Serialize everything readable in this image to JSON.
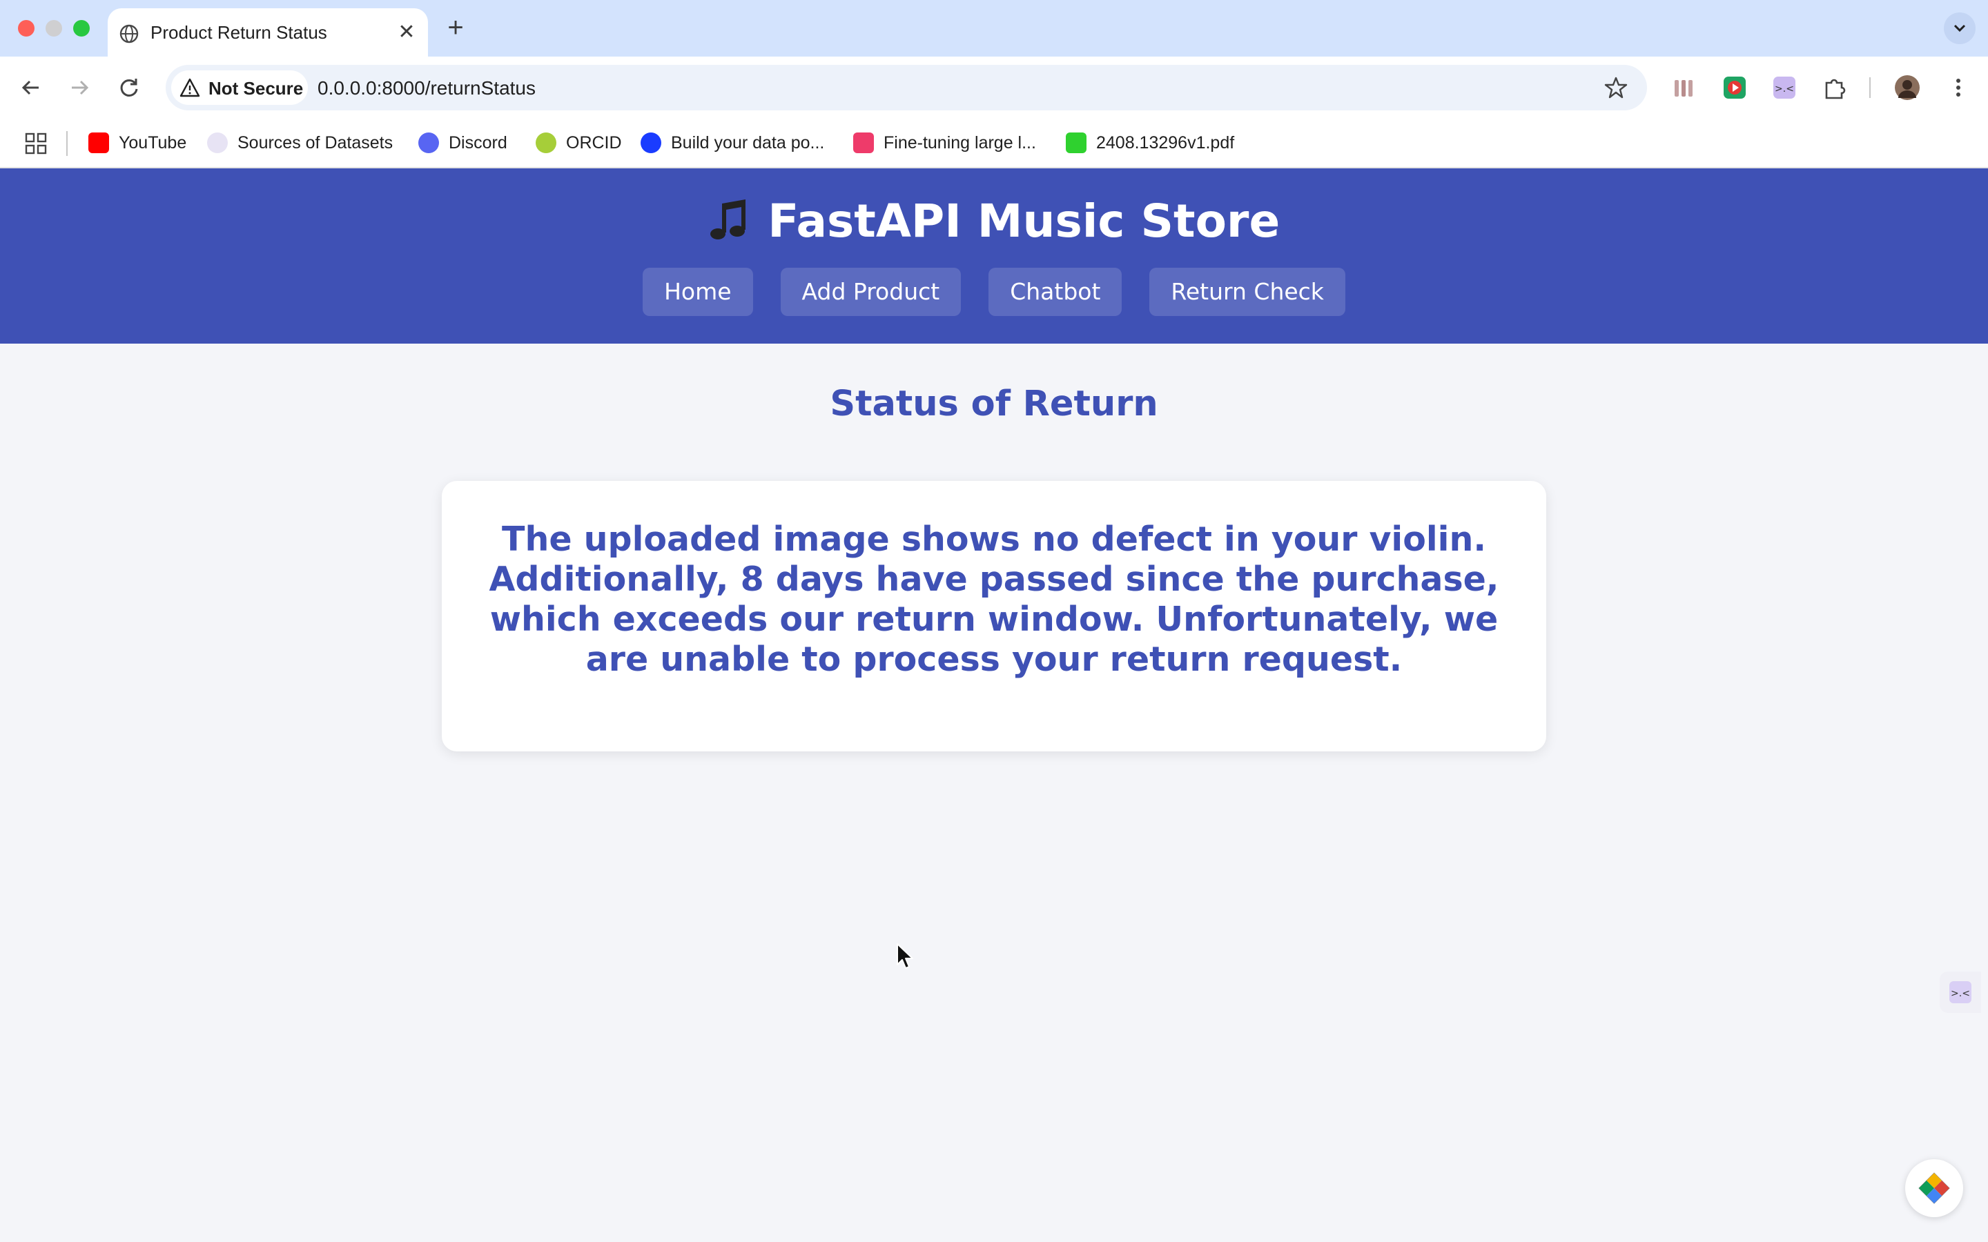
{
  "browser": {
    "tab": {
      "title": "Product Return Status",
      "close_glyph": "✕",
      "new_tab_glyph": "+"
    },
    "address_bar": {
      "security_label": "Not Secure",
      "url": "0.0.0.0:8000/returnStatus"
    },
    "bookmarks": [
      {
        "label": "YouTube",
        "icon": "youtube-icon"
      },
      {
        "label": "Sources of Datasets",
        "icon": "datasets-icon"
      },
      {
        "label": "Discord",
        "icon": "discord-icon"
      },
      {
        "label": "ORCID",
        "icon": "orcid-icon"
      },
      {
        "label": "Build your data po...",
        "icon": "d-icon"
      },
      {
        "label": "Fine-tuning large l...",
        "icon": "finetune-icon"
      },
      {
        "label": "2408.13296v1.pdf",
        "icon": "pdf-icon"
      }
    ]
  },
  "site": {
    "title": "FastAPI Music Store",
    "title_icon": "musical-note-icon",
    "nav": [
      {
        "label": "Home"
      },
      {
        "label": "Add Product"
      },
      {
        "label": "Chatbot"
      },
      {
        "label": "Return Check"
      }
    ]
  },
  "page": {
    "heading": "Status of Return",
    "message": "The uploaded image shows no defect in your violin. Additionally, 8 days have passed since the purchase, which exceeds our return window. Unfortunately, we are unable to process your return request."
  },
  "colors": {
    "header_bg": "#3f51b5",
    "nav_button_bg": "#5c6bc0",
    "accent_text": "#3f51b5",
    "page_bg": "#f4f5f9"
  }
}
